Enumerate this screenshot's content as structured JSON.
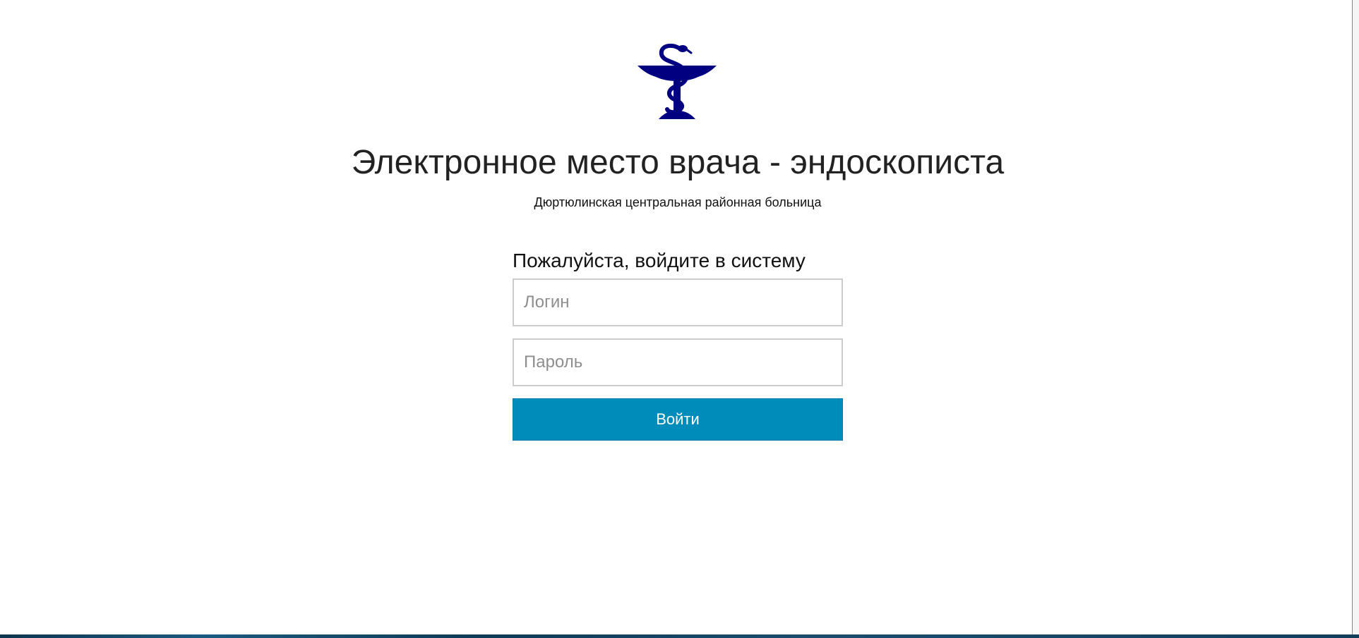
{
  "logo": {
    "icon": "bowl-of-hygieia-icon",
    "color": "#000080"
  },
  "header": {
    "title": "Электронное место врача - эндоскописта",
    "subtitle": "Дюртюлинская центральная районная больница"
  },
  "login": {
    "heading": "Пожалуйста, войдите в систему",
    "username_placeholder": "Логин",
    "username_value": "",
    "password_placeholder": "Пароль",
    "password_value": "",
    "submit_label": "Войти"
  },
  "colors": {
    "accent": "#008cba",
    "logo": "#000080",
    "taskbar": "#123e5c"
  }
}
